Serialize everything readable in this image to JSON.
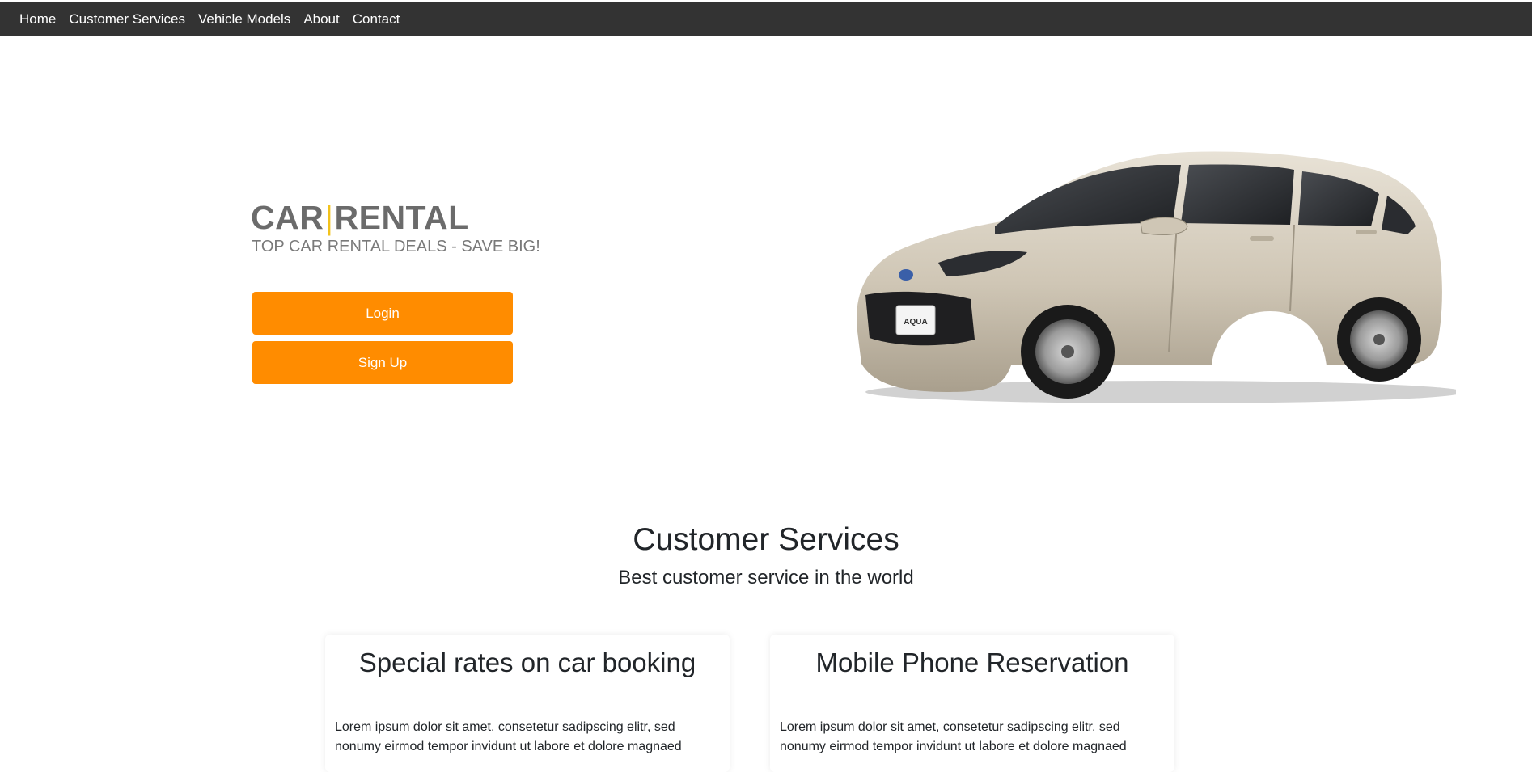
{
  "nav": {
    "items": [
      {
        "label": "Home"
      },
      {
        "label": "Customer Services"
      },
      {
        "label": "Vehicle Models"
      },
      {
        "label": "About"
      },
      {
        "label": "Contact"
      }
    ]
  },
  "hero": {
    "brand_left": "CAR",
    "brand_right": "RENTAL",
    "tagline": "TOP CAR RENTAL DEALS - SAVE BIG!",
    "login_label": "Login",
    "signup_label": "Sign Up",
    "car_plate": "AQUA"
  },
  "services": {
    "title": "Customer Services",
    "subtitle": "Best customer service in the world",
    "cards": [
      {
        "title": "Special rates on car booking",
        "text": "Lorem ipsum dolor sit amet, consetetur sadipscing elitr, sed nonumy eirmod tempor invidunt ut labore et dolore magnaed"
      },
      {
        "title": "Mobile Phone Reservation",
        "text": "Lorem ipsum dolor sit amet, consetetur sadipscing elitr, sed nonumy eirmod tempor invidunt ut labore et dolore magnaed"
      }
    ]
  },
  "colors": {
    "navbar": "#333333",
    "accent": "#ff8c00",
    "brand_separator": "#f2c21b",
    "brand_text": "#6b6b6b"
  }
}
